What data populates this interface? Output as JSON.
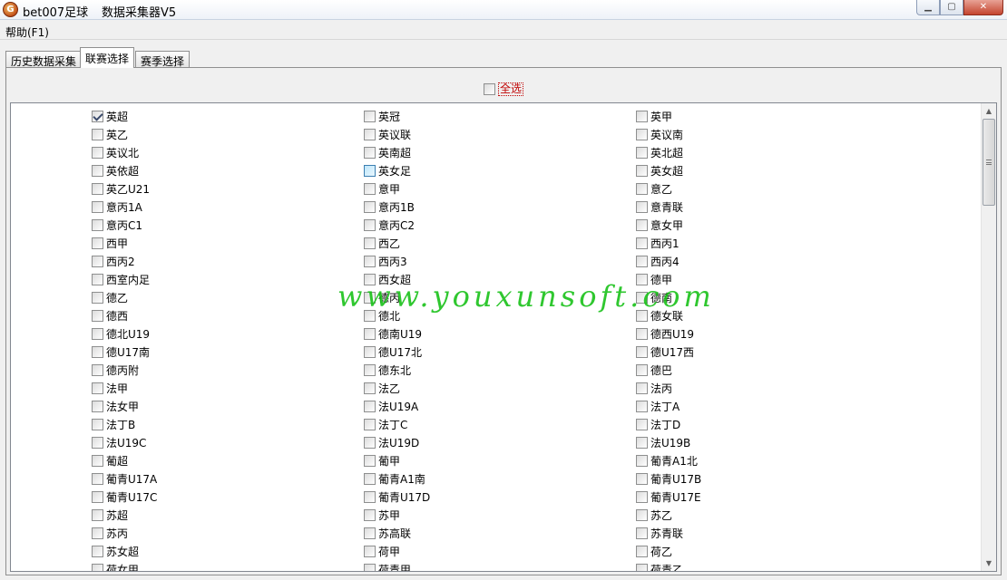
{
  "window": {
    "app_title": "bet007足球",
    "subtitle": "数据采集器V5",
    "icon_letter": "G",
    "controls": {
      "minimize": "▁",
      "maximize": "▢",
      "close": "✕"
    }
  },
  "menu": {
    "help": "帮助(F1)"
  },
  "tabs": [
    {
      "label": "历史数据采集",
      "active": false
    },
    {
      "label": "联赛选择",
      "active": true
    },
    {
      "label": "赛季选择",
      "active": false
    }
  ],
  "select_all": {
    "label": "全选",
    "checked": false
  },
  "leagues": {
    "columns": [
      [
        {
          "label": "英超",
          "checked": true
        },
        {
          "label": "英乙",
          "checked": false
        },
        {
          "label": "英议北",
          "checked": false
        },
        {
          "label": "英依超",
          "checked": false
        },
        {
          "label": "英乙U21",
          "checked": false
        },
        {
          "label": "意丙1A",
          "checked": false
        },
        {
          "label": "意丙C1",
          "checked": false
        },
        {
          "label": "西甲",
          "checked": false
        },
        {
          "label": "西丙2",
          "checked": false
        },
        {
          "label": "西室内足",
          "checked": false
        },
        {
          "label": "德乙",
          "checked": false
        },
        {
          "label": "德西",
          "checked": false
        },
        {
          "label": "德北U19",
          "checked": false
        },
        {
          "label": "德U17南",
          "checked": false
        },
        {
          "label": "德丙附",
          "checked": false
        },
        {
          "label": "法甲",
          "checked": false
        },
        {
          "label": "法女甲",
          "checked": false
        },
        {
          "label": "法丁B",
          "checked": false
        },
        {
          "label": "法U19C",
          "checked": false
        },
        {
          "label": "葡超",
          "checked": false
        },
        {
          "label": "葡青U17A",
          "checked": false
        },
        {
          "label": "葡青U17C",
          "checked": false
        },
        {
          "label": "苏超",
          "checked": false
        },
        {
          "label": "苏丙",
          "checked": false
        },
        {
          "label": "苏女超",
          "checked": false
        },
        {
          "label": "荷女甲",
          "checked": false
        }
      ],
      [
        {
          "label": "英冠",
          "checked": false
        },
        {
          "label": "英议联",
          "checked": false
        },
        {
          "label": "英南超",
          "checked": false
        },
        {
          "label": "英女足",
          "checked": false,
          "hover": true
        },
        {
          "label": "意甲",
          "checked": false
        },
        {
          "label": "意丙1B",
          "checked": false
        },
        {
          "label": "意丙C2",
          "checked": false
        },
        {
          "label": "西乙",
          "checked": false
        },
        {
          "label": "西丙3",
          "checked": false
        },
        {
          "label": "西女超",
          "checked": false
        },
        {
          "label": "德丙",
          "checked": false
        },
        {
          "label": "德北",
          "checked": false
        },
        {
          "label": "德南U19",
          "checked": false
        },
        {
          "label": "德U17北",
          "checked": false
        },
        {
          "label": "德东北",
          "checked": false
        },
        {
          "label": "法乙",
          "checked": false
        },
        {
          "label": "法U19A",
          "checked": false
        },
        {
          "label": "法丁C",
          "checked": false
        },
        {
          "label": "法U19D",
          "checked": false
        },
        {
          "label": "葡甲",
          "checked": false
        },
        {
          "label": "葡青A1南",
          "checked": false
        },
        {
          "label": "葡青U17D",
          "checked": false
        },
        {
          "label": "苏甲",
          "checked": false
        },
        {
          "label": "苏高联",
          "checked": false
        },
        {
          "label": "荷甲",
          "checked": false
        },
        {
          "label": "荷青甲",
          "checked": false
        }
      ],
      [
        {
          "label": "英甲",
          "checked": false
        },
        {
          "label": "英议南",
          "checked": false
        },
        {
          "label": "英北超",
          "checked": false
        },
        {
          "label": "英女超",
          "checked": false
        },
        {
          "label": "意乙",
          "checked": false
        },
        {
          "label": "意青联",
          "checked": false
        },
        {
          "label": "意女甲",
          "checked": false
        },
        {
          "label": "西丙1",
          "checked": false
        },
        {
          "label": "西丙4",
          "checked": false
        },
        {
          "label": "德甲",
          "checked": false
        },
        {
          "label": "德南",
          "checked": false
        },
        {
          "label": "德女联",
          "checked": false
        },
        {
          "label": "德西U19",
          "checked": false
        },
        {
          "label": "德U17西",
          "checked": false
        },
        {
          "label": "德巴",
          "checked": false
        },
        {
          "label": "法丙",
          "checked": false
        },
        {
          "label": "法丁A",
          "checked": false
        },
        {
          "label": "法丁D",
          "checked": false
        },
        {
          "label": "法U19B",
          "checked": false
        },
        {
          "label": "葡青A1北",
          "checked": false
        },
        {
          "label": "葡青U17B",
          "checked": false
        },
        {
          "label": "葡青U17E",
          "checked": false
        },
        {
          "label": "苏乙",
          "checked": false
        },
        {
          "label": "苏青联",
          "checked": false
        },
        {
          "label": "荷乙",
          "checked": false
        },
        {
          "label": "荷青乙",
          "checked": false
        }
      ]
    ]
  },
  "scrollbar": {
    "up_icon": "▲",
    "down_icon": "▼"
  },
  "watermark": "www.youxunsoft.com"
}
